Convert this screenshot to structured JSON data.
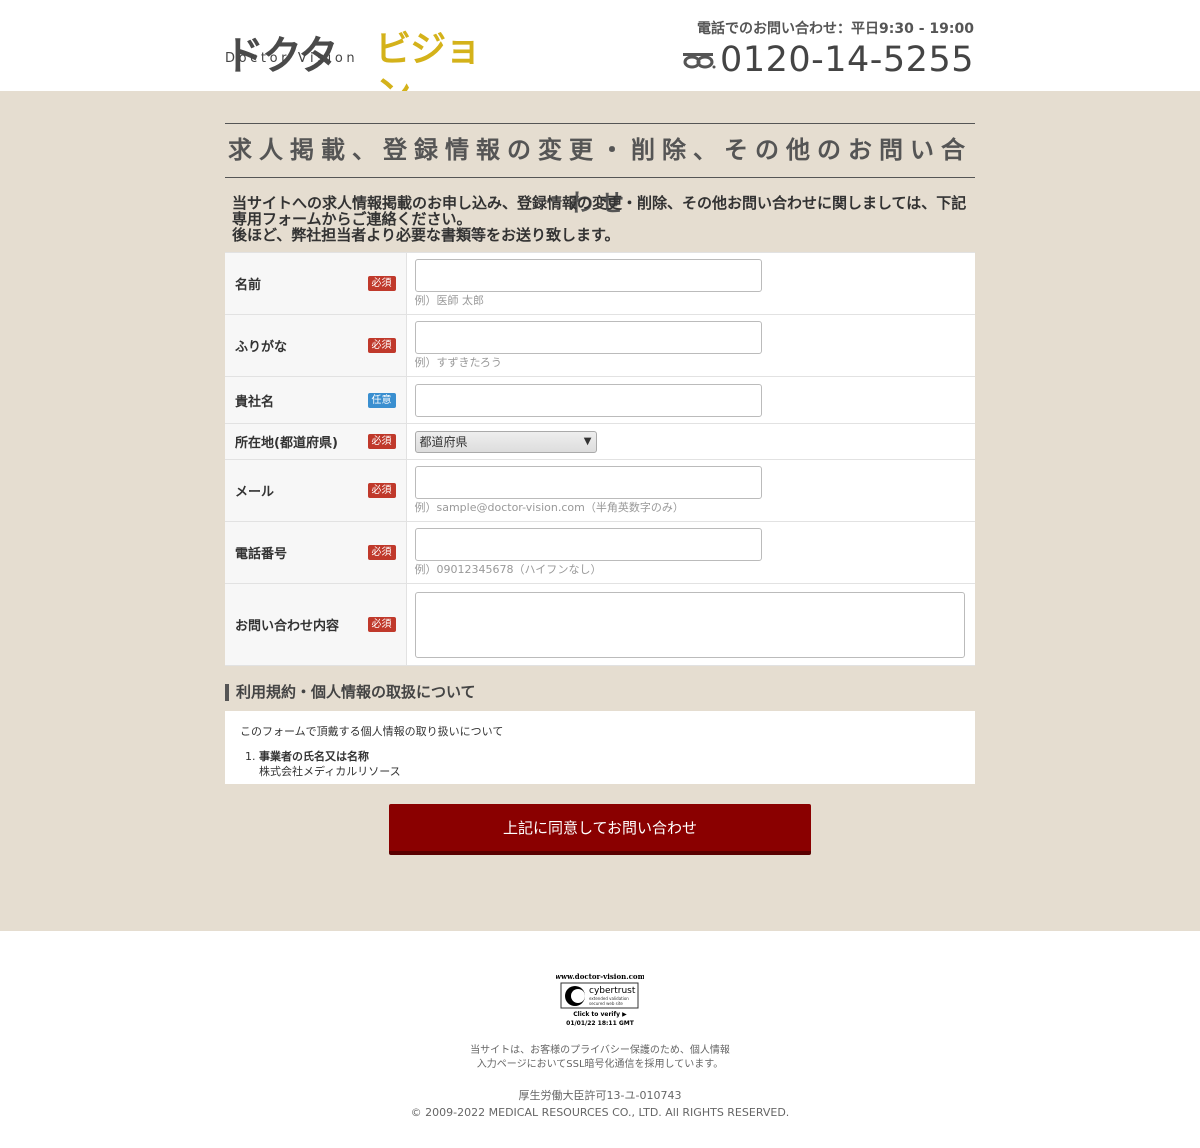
{
  "header": {
    "logo_jp_part1": "ドクター",
    "logo_jp_part2": "ビジョン",
    "logo_en": "Doctor Vision",
    "phone_hours": "電話でのお問い合わせ：平日9:30 - 19:00",
    "phone_number": "0120-14-5255",
    "freedial_icon": "free-dial-icon"
  },
  "main": {
    "page_title": "求人掲載、登録情報の変更・削除、その他のお問い合わせ",
    "intro_line1": "当サイトへの求人情報掲載のお申し込み、登録情報の変更・削除、その他お問い合わせに関しましては、下記",
    "intro_line2": "専用フォームからご連絡ください。",
    "intro_line3": "後ほど、弊社担当者より必要な書類等をお送り致します。",
    "required_badge": "必須",
    "optional_badge": "任意",
    "form": {
      "name_label": "名前",
      "name_example": "例）医師 太郎",
      "furigana_label": "ふりがな",
      "furigana_example": "例）すずきたろう",
      "company_label": "貴社名",
      "location_label": "所在地(都道府県)",
      "location_selected": "都道府県",
      "email_label": "メール",
      "email_example": "例）sample@doctor-vision.com（半角英数字のみ）",
      "phone_label": "電話番号",
      "phone_example": "例）09012345678（ハイフンなし）",
      "inquiry_label": "お問い合わせ内容"
    },
    "terms": {
      "heading": "利用規約・個人情報の取扱について",
      "intro": "このフォームで頂戴する個人情報の取り扱いについて",
      "item1_title": "事業者の氏名又は名称",
      "item1_body": "株式会社メディカルリソース"
    },
    "submit_label": "上記に同意してお問い合わせ"
  },
  "footer": {
    "seal_domain": "www.doctor-vision.com",
    "seal_brand": "cybertrust",
    "seal_sub1": "extended validation",
    "seal_sub2": "secured web site",
    "seal_verify": "Click to verify ▶",
    "seal_date": "01/01/22 18:11 GMT",
    "ssl_line1": "当サイトは、お客様のプライバシー保護のため、個人情報",
    "ssl_line2": "入力ページにおいてSSL暗号化通信を採用しています。",
    "license": "厚生労働大臣許可13-ユ-010743",
    "copyright": "© 2009-2022 MEDICAL RESOURCES CO., LTD. All RIGHTS RESERVED."
  }
}
